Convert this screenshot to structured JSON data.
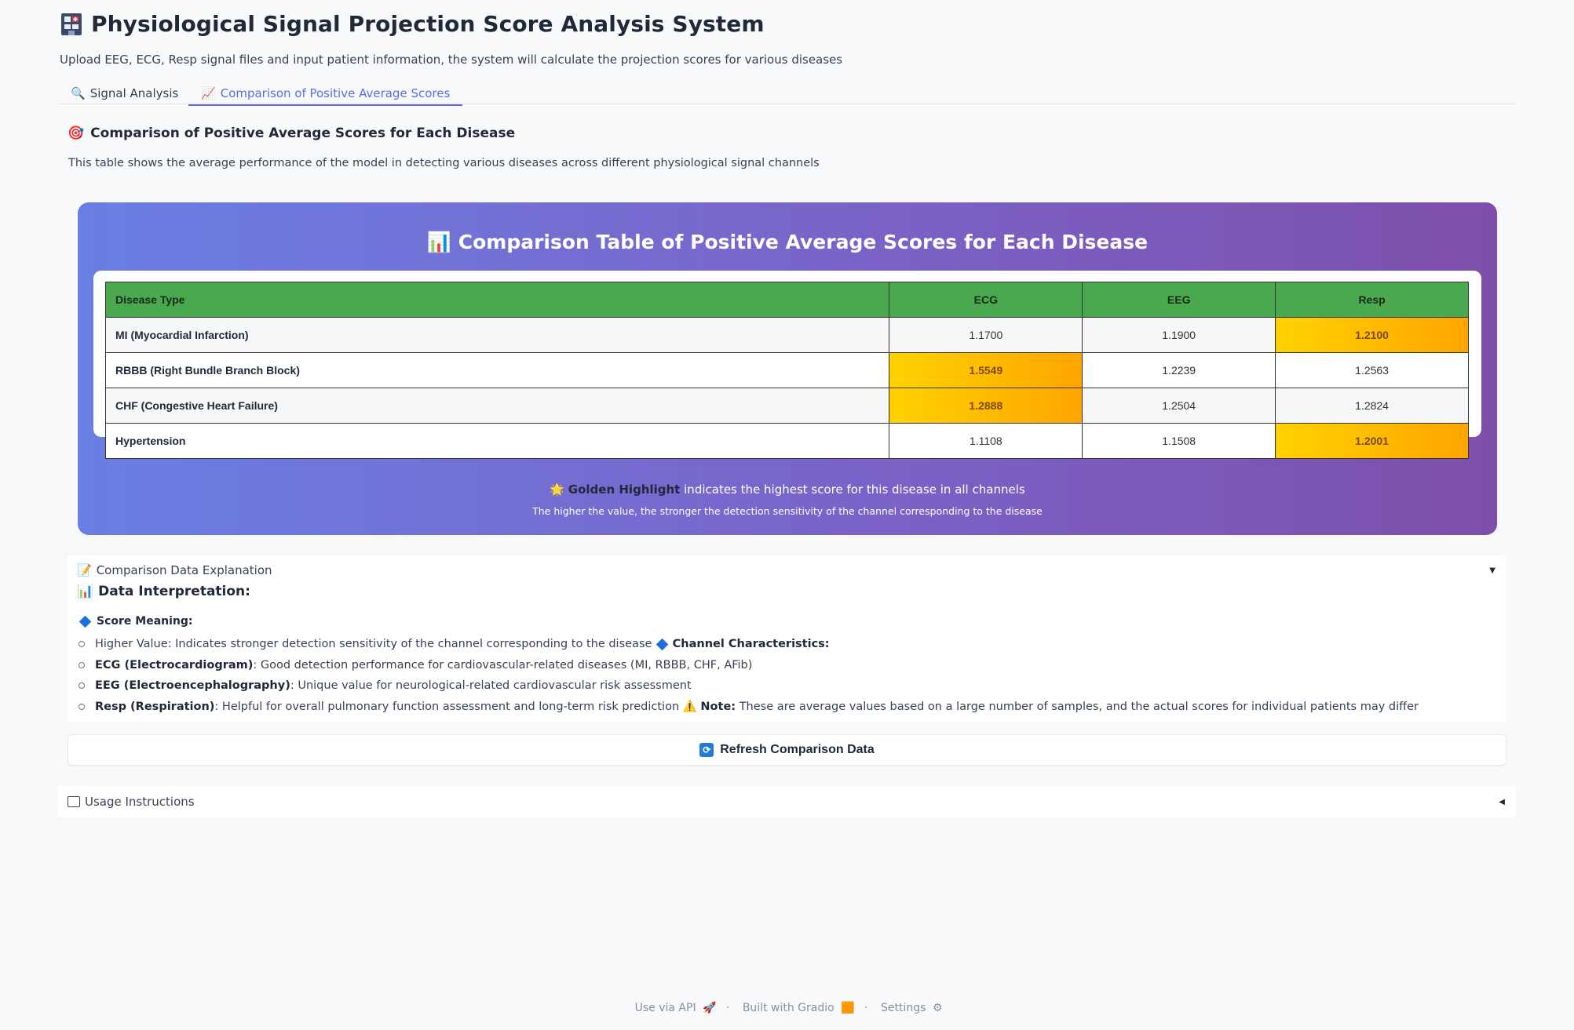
{
  "app": {
    "title": "Physiological Signal Projection Score Analysis System",
    "subtitle": "Upload EEG, ECG, Resp signal files and input patient information, the system will calculate the projection scores for various diseases"
  },
  "tabs": [
    {
      "icon": "🔍",
      "label": "Signal Analysis",
      "active": false
    },
    {
      "icon": "📈",
      "label": "Comparison of Positive Average Scores",
      "active": true
    }
  ],
  "section": {
    "icon": "🎯",
    "title": "Comparison of Positive Average Scores for Each Disease",
    "description": "This table shows the average performance of the model in detecting various diseases across different physiological signal channels"
  },
  "card": {
    "icon": "📊",
    "title": "Comparison Table of Positive Average Scores for Each Disease",
    "legend_icon": "🌟",
    "legend_bold": "Golden Highlight",
    "legend_text": "indicates the highest score for this disease in all channels",
    "legend_sub": "The higher the value, the stronger the detection sensitivity of the channel corresponding to the disease",
    "highlight_color": "#ffc107"
  },
  "table": {
    "headers": [
      "Disease Type",
      "ECG",
      "EEG",
      "Resp"
    ],
    "rows": [
      {
        "disease": "MI (Myocardial Infarction)",
        "ECG": "1.1700",
        "EEG": "1.1900",
        "Resp": "1.2100",
        "max": "Resp"
      },
      {
        "disease": "RBBB (Right Bundle Branch Block)",
        "ECG": "1.5549",
        "EEG": "1.2239",
        "Resp": "1.2563",
        "max": "ECG"
      },
      {
        "disease": "CHF (Congestive Heart Failure)",
        "ECG": "1.2888",
        "EEG": "1.2504",
        "Resp": "1.2824",
        "max": "ECG"
      },
      {
        "disease": "Hypertension",
        "ECG": "1.1108",
        "EEG": "1.1508",
        "Resp": "1.2001",
        "max": "Resp"
      }
    ]
  },
  "explanation": {
    "accordion_label": "Comparison Data Explanation",
    "caret": "▼",
    "heading": "Data Interpretation:",
    "score_meaning": "Score Meaning:",
    "higher_value": "Higher Value: Indicates stronger detection sensitivity of the channel corresponding to the disease",
    "channel_characteristics": "Channel Characteristics:",
    "ecg_label": "ECG (Electrocardiogram)",
    "ecg_text": ": Good detection performance for cardiovascular-related diseases (MI, RBBB, CHF, AFib)",
    "eeg_label": "EEG (Electroencephalography)",
    "eeg_text": ": Unique value for neurological-related cardiovascular risk assessment",
    "resp_label": "Resp (Respiration)",
    "resp_text": ": Helpful for overall pulmonary function assessment and long-term risk prediction",
    "note_label": "Note:",
    "note_text": "These are average values based on a large number of samples, and the actual scores for individual patients may differ"
  },
  "refresh_button": {
    "icon": "🔄",
    "label": "Refresh Comparison Data"
  },
  "usage": {
    "label": "Usage Instructions",
    "caret": "◀"
  },
  "footer": {
    "api": "Use via API",
    "gradio": "Built with Gradio",
    "settings": "Settings"
  }
}
